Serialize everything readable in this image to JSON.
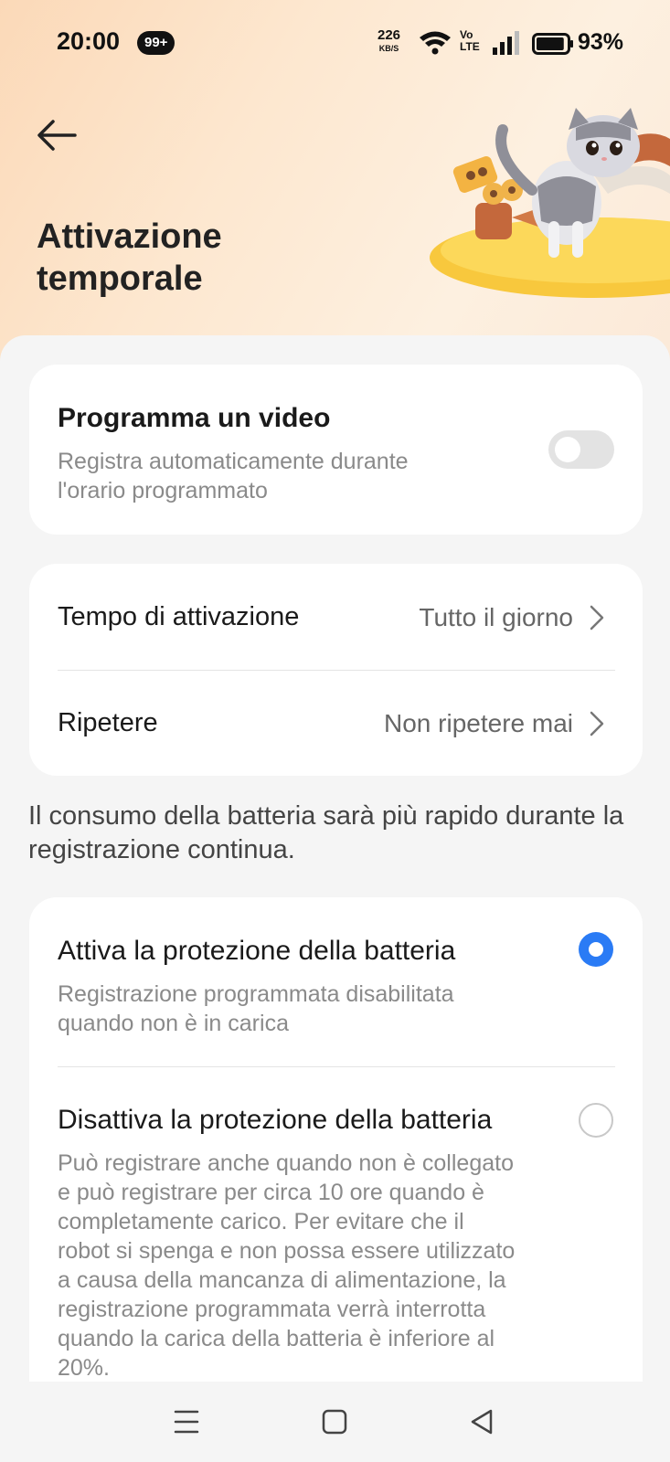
{
  "status_bar": {
    "time": "20:00",
    "notif_count": "99+",
    "net_speed": "226",
    "net_unit": "KB/S",
    "volte_line1": "Vo",
    "volte_line2": "LTE",
    "battery_pct": "93%",
    "battery_level": 0.93
  },
  "header": {
    "title": "Attivazione temporale"
  },
  "schedule_card": {
    "title": "Programma un video",
    "subtitle_line1": "Registra automaticamente durante",
    "subtitle_line2": "l'orario programmato",
    "toggle_on": false
  },
  "settings": {
    "activation_label": "Tempo di attivazione",
    "activation_value": "Tutto il giorno",
    "repeat_label": "Ripetere",
    "repeat_value": "Non ripetere mai"
  },
  "battery_note": "Il consumo della batteria sarà più rapido durante la registrazione continua.",
  "battery_options": {
    "option1_title": "Attiva la protezione della batteria",
    "option1_desc_line1": "Registrazione programmata disabilitata",
    "option1_desc_line2": "quando non è in carica",
    "option1_selected": true,
    "option2_title": "Disattiva la protezione della batteria",
    "option2_desc": [
      "Può registrare anche quando non è collegato",
      "e può registrare per circa 10 ore quando è",
      "completamente carico. Per evitare che il",
      "robot si spenga e non possa essere utilizzato",
      "a causa della mancanza di alimentazione, la",
      "registrazione programmata verrà interrotta",
      "quando la carica della batteria è inferiore al",
      "20%."
    ],
    "option2_selected": false
  },
  "icons": {
    "back": "back-arrow-icon",
    "chevron": "chevron-right-icon",
    "nav_menu": "menu-icon",
    "nav_home": "home-square-icon",
    "nav_back": "back-triangle-icon"
  },
  "colors": {
    "accent": "#2a7bf5",
    "hero_gradient_start": "#fbd9b8",
    "card_bg": "#ffffff",
    "page_bg": "#f5f5f5"
  }
}
